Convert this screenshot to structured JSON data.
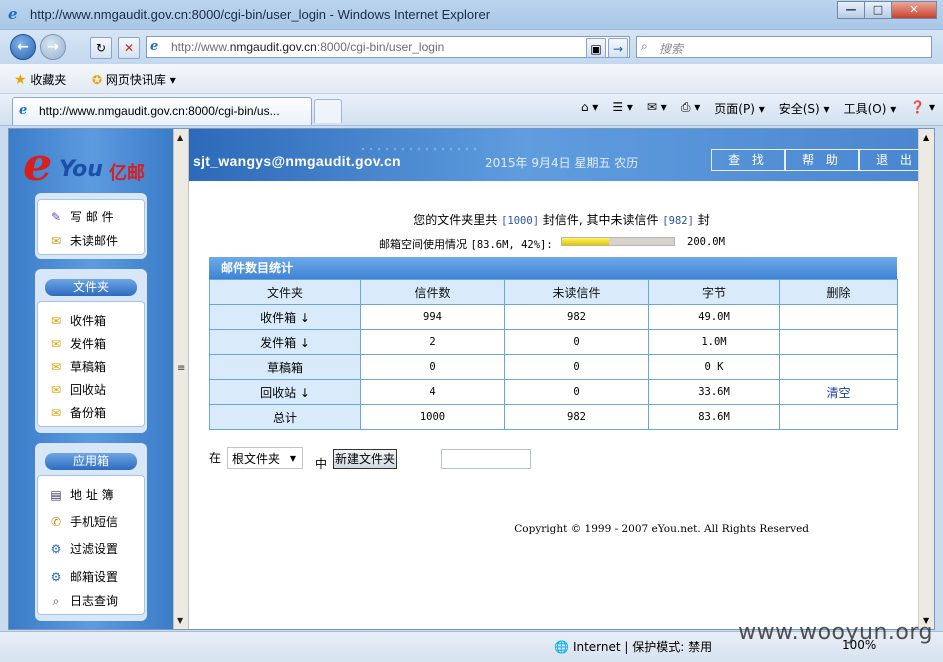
{
  "browser": {
    "window_title": "http://www.nmgaudit.gov.cn:8000/cgi-bin/user_login - Windows Internet Explorer",
    "url_prefix": "http://www.",
    "url_host": "nmgaudit.gov.cn",
    "url_suffix": ":8000/cgi-bin/user_login",
    "search_placeholder": "搜索",
    "favorites_label": "收藏夹",
    "quicklink_label": "网页快讯库",
    "tab_title": "http://www.nmgaudit.gov.cn:8000/cgi-bin/us...",
    "cmd_page": "页面(P)",
    "cmd_safety": "安全(S)",
    "cmd_tools": "工具(O)",
    "status_zone": "Internet | 保护模式: 禁用",
    "zoom": "100%",
    "watermark": "www.wooyun.org"
  },
  "sidebar": {
    "logo_e": "e",
    "logo_you": "You",
    "logo_cn": "亿邮",
    "compose": "写 邮 件",
    "unread": "未读邮件",
    "folders_head": "文件夹",
    "folders": [
      "收件箱",
      "发件箱",
      "草稿箱",
      "回收站",
      "备份箱"
    ],
    "apps_head": "应用箱",
    "apps": [
      "地 址 簿",
      "手机短信",
      "过滤设置",
      "邮箱设置",
      "日志查询"
    ]
  },
  "header": {
    "user": "sjt_wangys@nmgaudit.gov.cn",
    "date": "2015年  9月4日  星期五  农历",
    "btn_search": "查 找",
    "btn_help": "帮 助",
    "btn_logout": "退 出"
  },
  "summary": {
    "pre": "您的文件夹里共 ",
    "total": "[1000]",
    "mid": " 封信件, 其中未读信件 ",
    "unread": "[982]",
    "post": " 封",
    "usage_label": "邮箱空间使用情况 ",
    "usage_value": "[83.6M, 42%]:",
    "usage_percent": 42,
    "usage_max": "200.0M"
  },
  "stats": {
    "title": "邮件数目统计",
    "columns": [
      "文件夹",
      "信件数",
      "未读信件",
      "字节",
      "删除"
    ],
    "rows": [
      {
        "name": "收件箱 ↓",
        "count": "994",
        "unread": "982",
        "bytes": "49.0M",
        "del": ""
      },
      {
        "name": "发件箱 ↓",
        "count": "2",
        "unread": "0",
        "bytes": "1.0M",
        "del": ""
      },
      {
        "name": "草稿箱",
        "count": "0",
        "unread": "0",
        "bytes": "0 K",
        "del": ""
      },
      {
        "name": "回收站 ↓",
        "count": "4",
        "unread": "0",
        "bytes": "33.6M",
        "del": "清空"
      }
    ],
    "total": {
      "name": "总计",
      "count": "1000",
      "unread": "982",
      "bytes": "83.6M",
      "del": ""
    }
  },
  "folder_create": {
    "in_label": "在",
    "selected": "根文件夹",
    "middle_label": "中",
    "button": "新建文件夹"
  },
  "copyright": "Copyright © 1999 - 2007 eYou.net. All Rights Reserved"
}
